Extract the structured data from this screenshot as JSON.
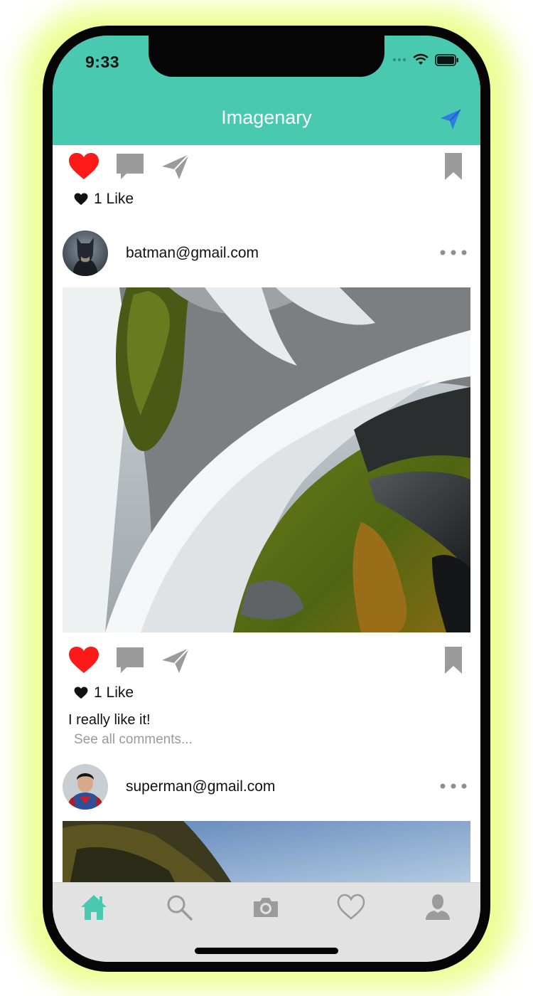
{
  "status_bar": {
    "time": "9:33"
  },
  "header": {
    "title": "Imagenary"
  },
  "feed": [
    {
      "likes_text": "1 Like"
    },
    {
      "user": "batman@gmail.com",
      "likes_text": "1 Like",
      "caption": "I really like it!",
      "see_all": "See all comments..."
    },
    {
      "user": "superman@gmail.com"
    }
  ],
  "tabbar": {
    "tabs": [
      "home",
      "search",
      "camera",
      "activity",
      "profile"
    ],
    "active": "home"
  },
  "colors": {
    "accent": "#48c9b0",
    "like": "#ff1a1a",
    "icon_gray": "#9b9b9b",
    "send": "#2f7de1"
  }
}
